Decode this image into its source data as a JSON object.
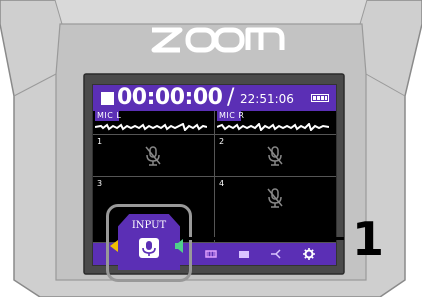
{
  "brand": {
    "logo_text": "ZOOM"
  },
  "screen": {
    "counter": "00:00:00",
    "slash": "/",
    "clock": "22:51:06",
    "channels": [
      {
        "label": "MIC L"
      },
      {
        "label": "MIC R"
      }
    ],
    "tracks": [
      "1",
      "2",
      "3",
      "4"
    ]
  },
  "callout": {
    "tab_label": "INPUT",
    "step_number": "1"
  },
  "colors": {
    "screen_accent": "#5b2fb5",
    "body": "#c6c6c6"
  }
}
